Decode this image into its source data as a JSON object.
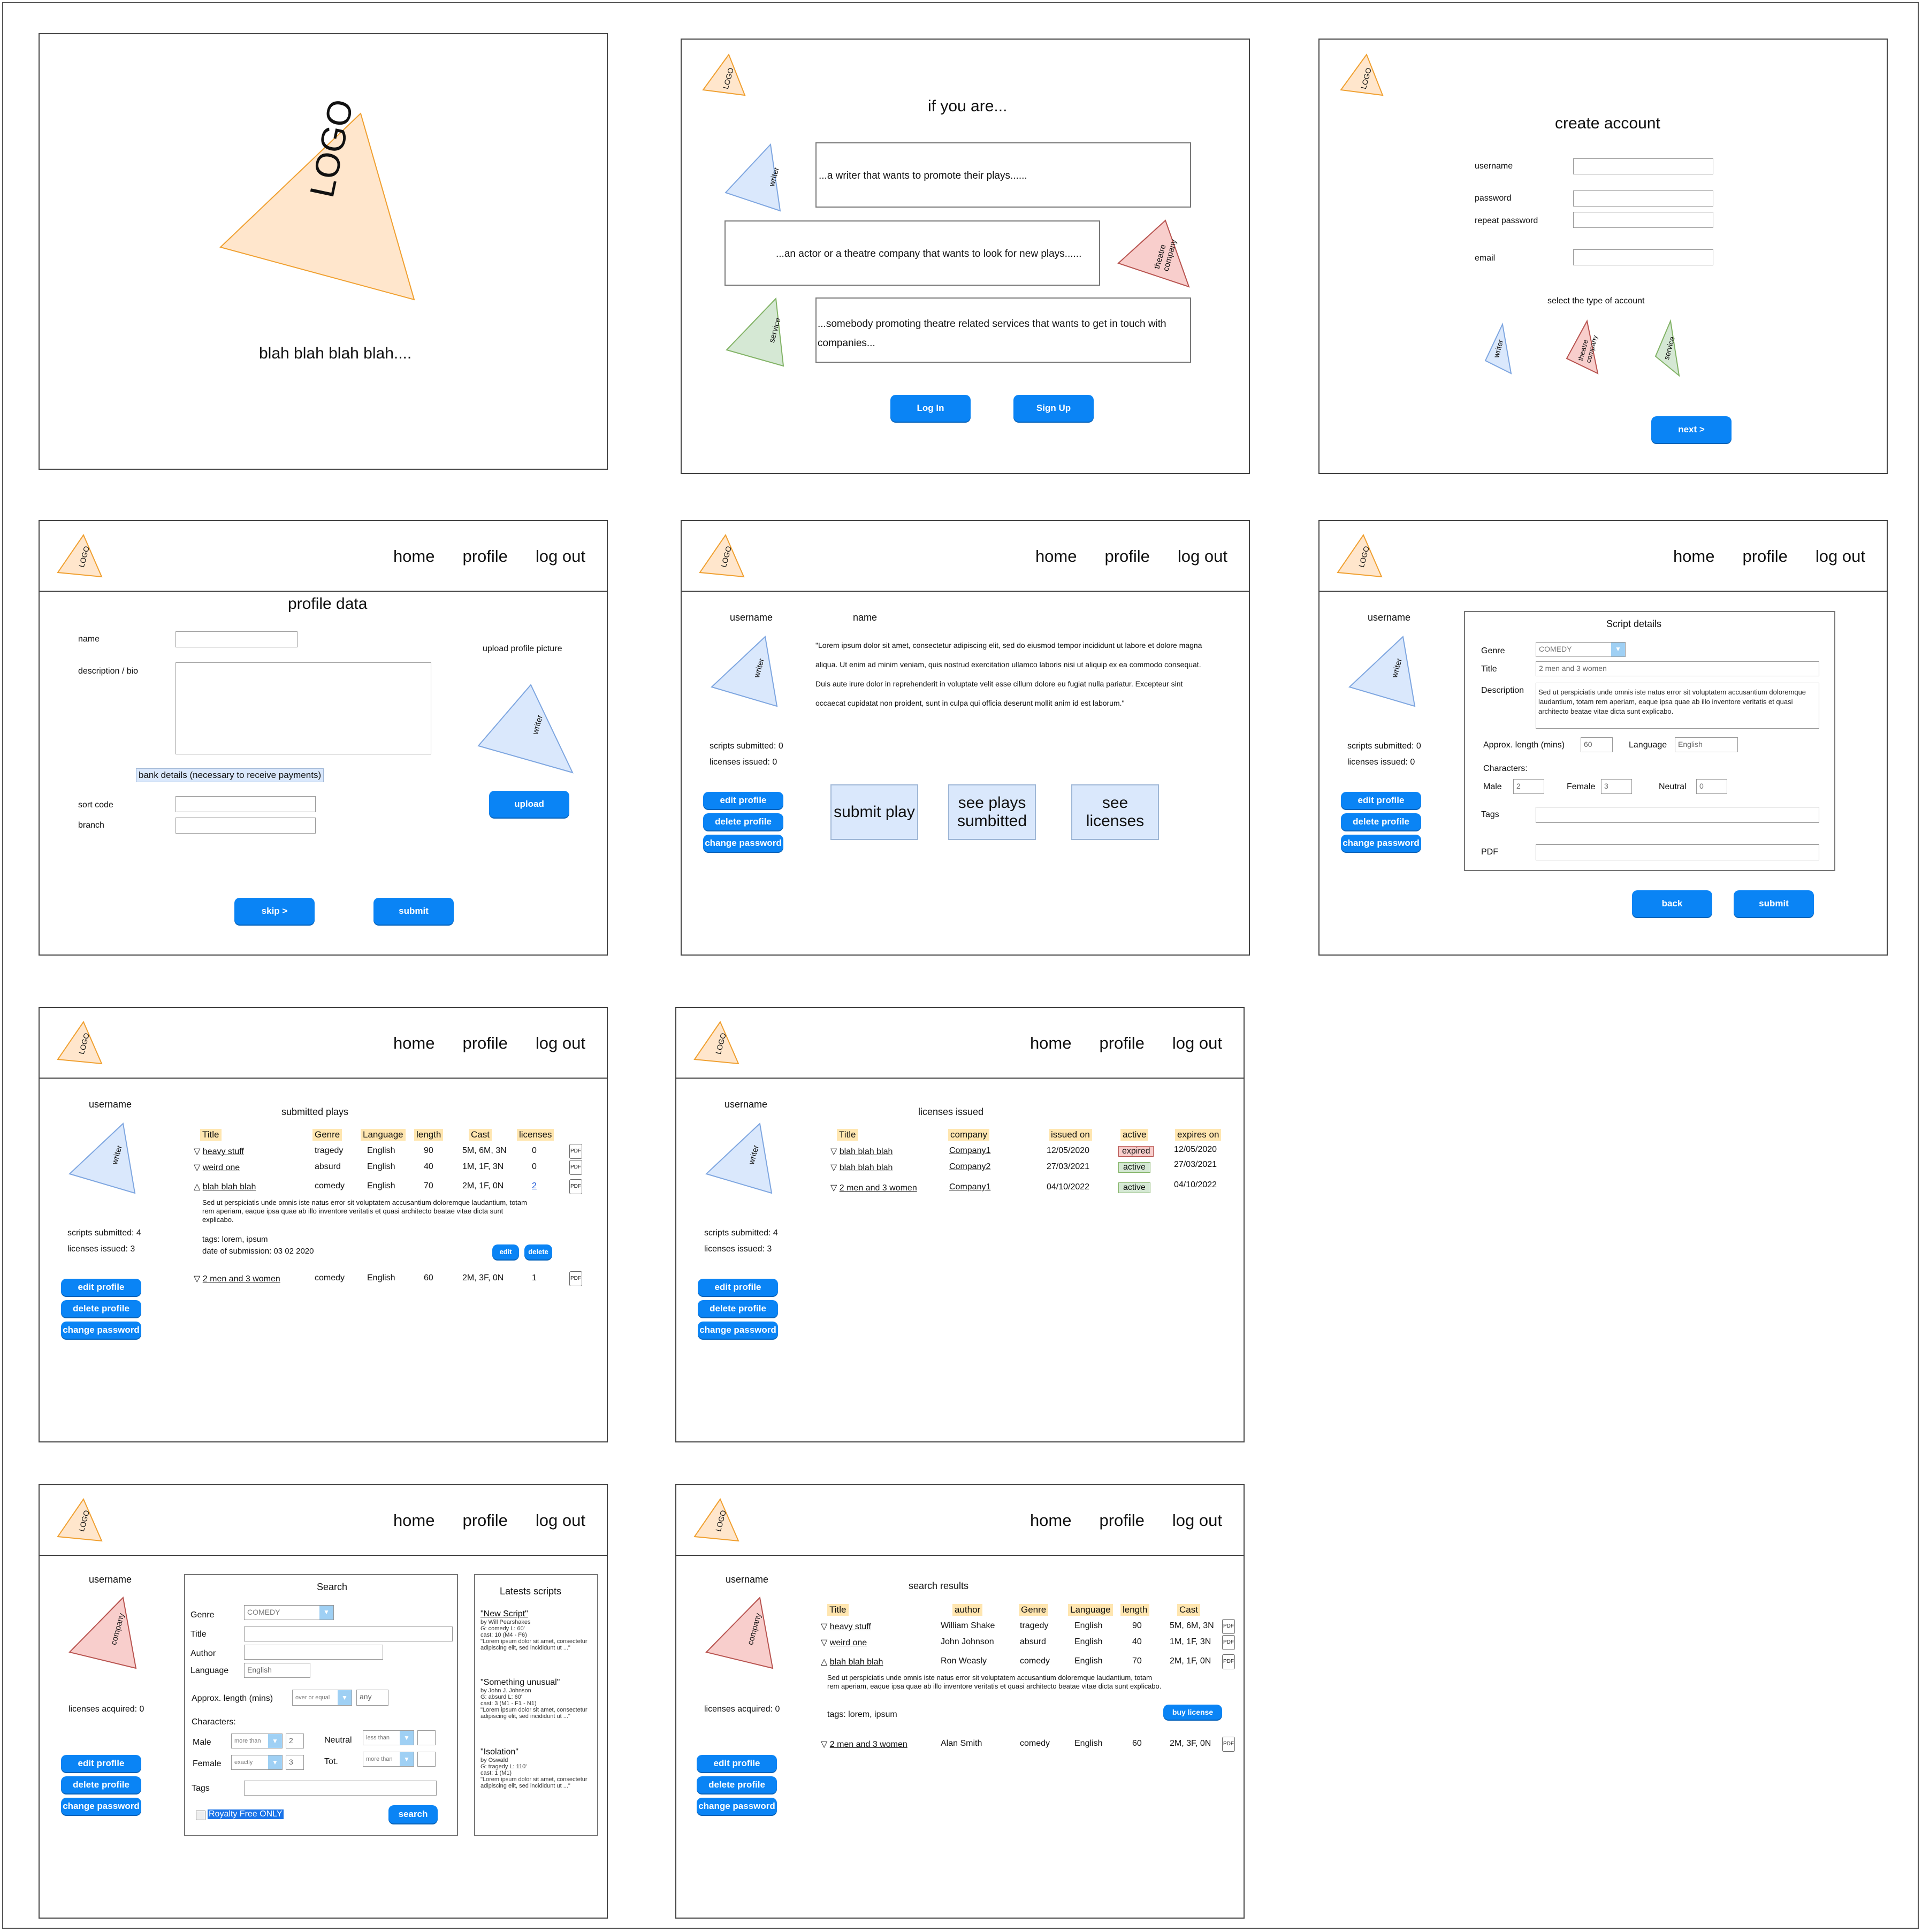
{
  "colors": {
    "accent": "#0a84f5",
    "logo": "#ffe6cc",
    "writer": "#dae8fc",
    "company": "#f8cecc",
    "service": "#d5e8d4",
    "header_cell": "#ffe6b0"
  },
  "nav": {
    "home": "home",
    "profile": "profile",
    "logout": "log out"
  },
  "logo_text": "LOGO",
  "sidebar": {
    "username": "username",
    "writer": "writer",
    "company": "company",
    "edit": "edit profile",
    "delete": "delete profile",
    "change_pw": "change password"
  },
  "splash": {
    "tagline": "blah blah blah blah...."
  },
  "landing": {
    "title": "if you are...",
    "writer_role": "writer",
    "company_role": "theatre company",
    "service_role": "service",
    "writer_text": "...a writer that wants to promote their plays......",
    "company_text": "...an actor or a theatre company that wants to look for new plays......",
    "service_text": "...somebody promoting theatre related services that wants to get in touch with companies...",
    "login": "Log In",
    "signup": "Sign Up"
  },
  "create": {
    "title": "create account",
    "username": "username",
    "password": "password",
    "repeat": "repeat password",
    "email": "email",
    "select": "select the type of account",
    "writer": "writer",
    "company": "theatre company",
    "service": "service",
    "next": "next >"
  },
  "profile_data": {
    "title": "profile data",
    "name": "name",
    "bio": "description / bio",
    "upload_label": "upload profile picture",
    "writer": "writer",
    "bank": "bank details (necessary to receive payments)",
    "sort": "sort code",
    "branch": "branch",
    "upload": "upload",
    "skip": "skip >",
    "submit": "submit"
  },
  "profile": {
    "username": "username",
    "name": "name",
    "bio": "\"Lorem ipsum dolor sit amet, consectetur adipiscing elit, sed do eiusmod tempor incididunt ut labore et dolore magna aliqua. Ut enim ad minim veniam, quis nostrud exercitation ullamco laboris nisi ut aliquip ex ea commodo consequat. Duis aute irure dolor in reprehenderit in voluptate velit esse cillum dolore eu fugiat nulla pariatur. Excepteur sint occaecat cupidatat non proident, sunt in culpa qui officia deserunt mollit anim id est laborum.\"",
    "scripts": "scripts submitted: 0",
    "licenses": "licenses issued: 0",
    "submit_play": "submit play",
    "see_plays": "see plays sumbitted",
    "see_licenses": "see licenses"
  },
  "script": {
    "title": "Script details",
    "genre": "Genre",
    "genre_val": "COMEDY",
    "title_label": "Title",
    "title_val": "2 men and 3 women",
    "desc": "Description",
    "desc_val": "Sed ut perspiciatis unde omnis iste natus error sit voluptatem accusantium doloremque laudantium, totam rem aperiam, eaque ipsa quae ab illo inventore veritatis et quasi architecto beatae vitae dicta sunt explicabo.",
    "length": "Approx. length (mins)",
    "length_val": "60",
    "language": "Language",
    "language_val": "English",
    "characters": "Characters:",
    "male": "Male",
    "male_val": "2",
    "female": "Female",
    "female_val": "3",
    "neutral": "Neutral",
    "neutral_val": "0",
    "tags": "Tags",
    "pdf": "PDF",
    "back": "back",
    "submit": "submit",
    "scripts": "scripts submitted: 0",
    "licenses": "licenses issued: 0"
  },
  "plays": {
    "title": "submitted plays",
    "scripts": "scripts submitted: 4",
    "licenses": "licenses issued: 3",
    "headers": [
      "Title",
      "Genre",
      "Language",
      "length",
      "Cast",
      "licenses"
    ],
    "rows": [
      {
        "arrow": "▽",
        "title": "heavy stuff",
        "genre": "tragedy",
        "lang": "English",
        "len": "90",
        "cast": "5M, 6M, 3N",
        "lic": "0"
      },
      {
        "arrow": "▽",
        "title": "weird one",
        "genre": "absurd",
        "lang": "English",
        "len": "40",
        "cast": "1M, 1F, 3N",
        "lic": "0"
      },
      {
        "arrow": "△",
        "title": "blah blah blah",
        "genre": "comedy",
        "lang": "English",
        "len": "70",
        "cast": "2M, 1F, 0N",
        "lic": "2"
      },
      {
        "arrow": "▽",
        "title": "2 men and 3 women",
        "genre": "comedy",
        "lang": "English",
        "len": "60",
        "cast": "2M, 3F, 0N",
        "lic": "1"
      }
    ],
    "detail": "Sed ut perspiciatis unde omnis iste natus error sit voluptatem accusantium doloremque laudantium, totam rem aperiam, eaque ipsa quae ab illo inventore veritatis et quasi architecto beatae vitae dicta sunt explicabo.",
    "tags": "tags: lorem, ipsum",
    "date": "date of submission: 03 02 2020",
    "edit": "edit",
    "delete": "delete",
    "pdf": "PDF"
  },
  "licenses": {
    "title": "licenses issued",
    "scripts": "scripts submitted: 4",
    "licenses": "licenses issued: 3",
    "headers": [
      "Title",
      "company",
      "issued on",
      "active",
      "expires on"
    ],
    "rows": [
      {
        "title": "blah blah blah",
        "company": "Company1",
        "issued": "12/05/2020",
        "active": "expired",
        "expires": "12/05/2020"
      },
      {
        "title": "blah blah blah",
        "company": "Company2",
        "issued": "27/03/2021",
        "active": "active",
        "expires": "27/03/2021"
      },
      {
        "title": "2 men and 3 women",
        "company": "Company1",
        "issued": "04/10/2022",
        "active": "active",
        "expires": "04/10/2022"
      }
    ]
  },
  "search": {
    "title": "Search",
    "genre": "Genre",
    "genre_val": "COMEDY",
    "title_label": "Title",
    "author": "Author",
    "language": "Language",
    "language_val": "English",
    "length": "Approx. length (mins)",
    "length_op": "over or equal",
    "length_val": "any",
    "characters": "Characters:",
    "male": "Male",
    "male_op": "more than",
    "male_val": "2",
    "female": "Female",
    "female_op": "exactly",
    "female_val": "3",
    "neutral": "Neutral",
    "neutral_op": "less than",
    "tot": "Tot.",
    "tot_op": "more than",
    "tags": "Tags",
    "royalty": "Royalty Free ONLY",
    "search_btn": "search",
    "acquired": "licenses acquired: 0",
    "latest_title": "Latests scripts",
    "latest": [
      {
        "name": "\"New Script\"",
        "by": "by Will Pearshakes",
        "meta": "G: comedy  L: 60'",
        "cast": "cast: 10 (M4 - F6)",
        "excerpt": "\"Lorem ipsum dolor sit amet, consectetur adipiscing elit, sed incididunt ut ...\""
      },
      {
        "name": "\"Something unusual\"",
        "by": "by John J. Johnson",
        "meta": "G: absurd  L: 60'",
        "cast": "cast: 3 (M1 - F1 - N1)",
        "excerpt": "\"Lorem ipsum dolor sit amet, consectetur adipiscing elit, sed incididunt ut ...\""
      },
      {
        "name": "\"Isolation\"",
        "by": "by Oswald",
        "meta": "G: tragedy  L: 110'",
        "cast": "cast: 1 (M1)",
        "excerpt": "\"Lorem ipsum dolor sit amet, consectetur adipiscing elit, sed incididunt ut ...\""
      }
    ]
  },
  "results": {
    "title": "search results",
    "acquired": "licenses acquired: 0",
    "headers": [
      "Title",
      "author",
      "Genre",
      "Language",
      "length",
      "Cast"
    ],
    "rows": [
      {
        "arrow": "▽",
        "title": "heavy stuff",
        "author": "William Shake",
        "genre": "tragedy",
        "lang": "English",
        "len": "90",
        "cast": "5M, 6M, 3N"
      },
      {
        "arrow": "▽",
        "title": "weird one",
        "author": "John Johnson",
        "genre": "absurd",
        "lang": "English",
        "len": "40",
        "cast": "1M, 1F, 3N"
      },
      {
        "arrow": "△",
        "title": "blah blah blah",
        "author": "Ron Weasly",
        "genre": "comedy",
        "lang": "English",
        "len": "70",
        "cast": "2M, 1F, 0N"
      },
      {
        "arrow": "▽",
        "title": "2 men and 3 women",
        "author": "Alan Smith",
        "genre": "comedy",
        "lang": "English",
        "len": "60",
        "cast": "2M, 3F, 0N"
      }
    ],
    "detail": "Sed ut perspiciatis unde omnis iste natus error sit voluptatem accusantium doloremque laudantium, totam rem aperiam, eaque ipsa quae ab illo inventore veritatis et quasi architecto beatae vitae dicta sunt explicabo.",
    "tags": "tags: lorem, ipsum",
    "buy": "buy license",
    "pdf": "PDF"
  }
}
